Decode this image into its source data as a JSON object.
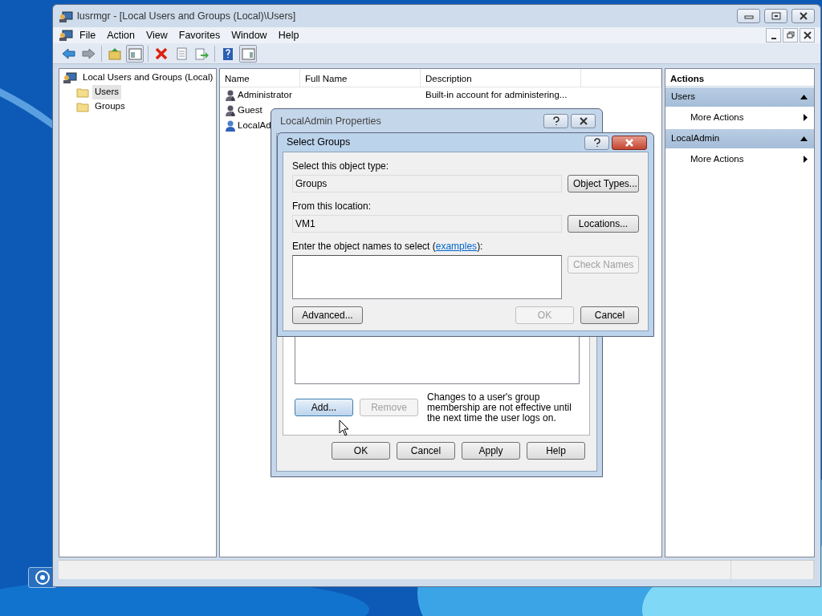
{
  "window": {
    "title": "lusrmgr - [Local Users and Groups (Local)\\Users]"
  },
  "menu": [
    "File",
    "Action",
    "View",
    "Favorites",
    "Window",
    "Help"
  ],
  "tree": {
    "label": "Local Users and Groups (Local)",
    "children": [
      {
        "label": "Users",
        "selected": true
      },
      {
        "label": "Groups",
        "selected": false
      }
    ]
  },
  "list": {
    "columns": [
      "Name",
      "Full Name",
      "Description"
    ],
    "rows": [
      {
        "name": "Administrator",
        "description": "Built-in account for administering..."
      },
      {
        "name": "Guest"
      },
      {
        "name": "LocalAd"
      }
    ]
  },
  "actions": {
    "title": "Actions",
    "sections": [
      {
        "heading": "Users",
        "items": [
          "More Actions"
        ]
      },
      {
        "heading": "LocalAdmin",
        "items": [
          "More Actions"
        ]
      }
    ]
  },
  "properties_dialog": {
    "title": "LocalAdmin Properties",
    "member_buttons": [
      {
        "label": "Add...",
        "disabled": false,
        "hovered": true
      },
      {
        "label": "Remove",
        "disabled": true,
        "hovered": false
      }
    ],
    "note": "Changes to a user's group membership are not effective until the next time the user logs on.",
    "footer_buttons": [
      "OK",
      "Cancel",
      "Apply",
      "Help"
    ]
  },
  "select_groups": {
    "title": "Select Groups",
    "object_type": {
      "label": "Select this object type:",
      "value": "Groups",
      "button": "Object Types..."
    },
    "location": {
      "label": "From this location:",
      "value": "VM1",
      "button": "Locations..."
    },
    "names": {
      "label": "Enter the object names to select (",
      "link": "examples",
      "label_end": "):",
      "button": {
        "label": "Check Names",
        "disabled": true
      }
    },
    "buttons": [
      {
        "label": "Advanced...",
        "disabled": false
      },
      {
        "label": "OK",
        "disabled": true
      },
      {
        "label": "Cancel",
        "disabled": false
      }
    ]
  }
}
